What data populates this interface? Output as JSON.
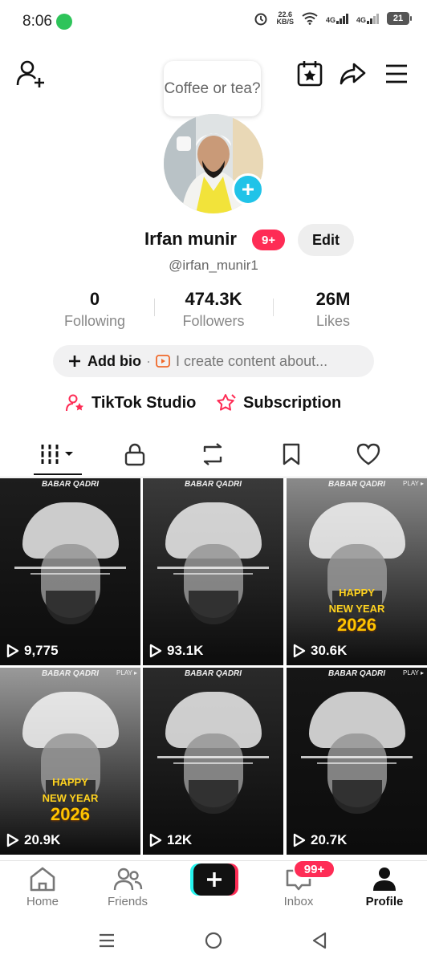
{
  "status_bar": {
    "time": "8:06",
    "speed_value": "22.6",
    "speed_unit": "KB/S",
    "network_1": "4G",
    "network_2": "4G",
    "battery": "21"
  },
  "header": {
    "bubble_text": "Coffee or tea?"
  },
  "profile": {
    "name": "Irfan munir",
    "notification_badge": "9+",
    "edit_label": "Edit",
    "handle": "@irfan_munir1"
  },
  "stats": [
    {
      "value": "0",
      "label": "Following"
    },
    {
      "value": "474.3K",
      "label": "Followers"
    },
    {
      "value": "26M",
      "label": "Likes"
    }
  ],
  "bio": {
    "add_label": "Add bio",
    "separator": "·",
    "create_text": "I create content about..."
  },
  "links": {
    "studio_label": "TikTok Studio",
    "subscription_label": "Subscription"
  },
  "videos": [
    {
      "views": "9,775",
      "watermark": "BABAR QADRI",
      "play_tag": "",
      "has_new_year": false,
      "bg": "#1d1d1d"
    },
    {
      "views": "93.1K",
      "watermark": "BABAR QADRI",
      "play_tag": "",
      "has_new_year": false,
      "bg": "#3a3a3a"
    },
    {
      "views": "30.6K",
      "watermark": "BABAR QADRI",
      "play_tag": "PLAY ▸",
      "has_new_year": true,
      "bg": "#8a8a8a"
    },
    {
      "views": "20.9K",
      "watermark": "BABAR QADRI",
      "play_tag": "PLAY ▸",
      "has_new_year": true,
      "bg": "#9a9a9a"
    },
    {
      "views": "12K",
      "watermark": "BABAR QADRI",
      "play_tag": "",
      "has_new_year": false,
      "bg": "#2a2a2a"
    },
    {
      "views": "20.7K",
      "watermark": "BABAR QADRI",
      "play_tag": "PLAY ▸",
      "has_new_year": false,
      "bg": "#161616"
    }
  ],
  "new_year": {
    "happy": "HAPPY",
    "new_year": "NEW YEAR",
    "year": "2026"
  },
  "bottom_nav": {
    "home": "Home",
    "friends": "Friends",
    "inbox": "Inbox",
    "inbox_badge": "99+",
    "profile": "Profile"
  },
  "colors": {
    "accent": "#fe2c55",
    "cyan": "#20c3e8"
  }
}
